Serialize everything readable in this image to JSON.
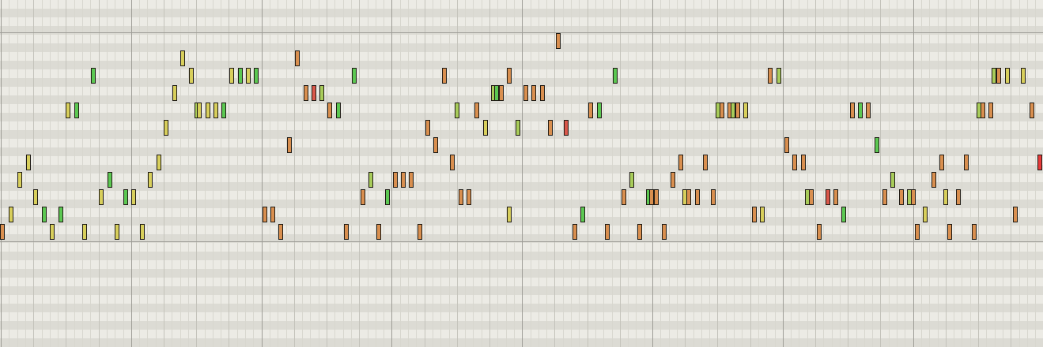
{
  "piano_roll": {
    "velocity_colors": {
      "green": "#5cc852",
      "lime": "#a8cc5a",
      "yellow": "#d8cf5c",
      "orange": "#d98f4f",
      "red": "#d9574a",
      "bright_red": "#e83a3a"
    },
    "notes": [
      {
        "time": 3,
        "pitch": 0,
        "color": "orange"
      },
      {
        "time": 14,
        "pitch": 1,
        "color": "yellow"
      },
      {
        "time": 25,
        "pitch": 3,
        "color": "yellow"
      },
      {
        "time": 36,
        "pitch": 4,
        "color": "yellow"
      },
      {
        "time": 45,
        "pitch": 2,
        "color": "yellow"
      },
      {
        "time": 56,
        "pitch": 1,
        "color": "green"
      },
      {
        "time": 66,
        "pitch": 0,
        "color": "yellow"
      },
      {
        "time": 77,
        "pitch": 1,
        "color": "green"
      },
      {
        "time": 86,
        "pitch": 7,
        "color": "yellow"
      },
      {
        "time": 97,
        "pitch": 7,
        "color": "green"
      },
      {
        "time": 107,
        "pitch": 0,
        "color": "yellow"
      },
      {
        "time": 118,
        "pitch": 9,
        "color": "green"
      },
      {
        "time": 128,
        "pitch": 2,
        "color": "yellow"
      },
      {
        "time": 139,
        "pitch": 3,
        "color": "green"
      },
      {
        "time": 148,
        "pitch": 0,
        "color": "yellow"
      },
      {
        "time": 159,
        "pitch": 2,
        "color": "green"
      },
      {
        "time": 169,
        "pitch": 2,
        "color": "yellow"
      },
      {
        "time": 180,
        "pitch": 0,
        "color": "yellow"
      },
      {
        "time": 190,
        "pitch": 3,
        "color": "yellow"
      },
      {
        "time": 201,
        "pitch": 4,
        "color": "yellow"
      },
      {
        "time": 210,
        "pitch": 6,
        "color": "yellow"
      },
      {
        "time": 221,
        "pitch": 8,
        "color": "yellow"
      },
      {
        "time": 231,
        "pitch": 10,
        "color": "yellow"
      },
      {
        "time": 242,
        "pitch": 9,
        "color": "yellow"
      },
      {
        "time": 249,
        "pitch": 7,
        "color": "lime"
      },
      {
        "time": 252,
        "pitch": 7,
        "color": "yellow"
      },
      {
        "time": 263,
        "pitch": 7,
        "color": "yellow"
      },
      {
        "time": 273,
        "pitch": 7,
        "color": "yellow"
      },
      {
        "time": 283,
        "pitch": 7,
        "color": "green"
      },
      {
        "time": 293,
        "pitch": 9,
        "color": "yellow"
      },
      {
        "time": 304,
        "pitch": 9,
        "color": "green"
      },
      {
        "time": 314,
        "pitch": 9,
        "color": "yellow"
      },
      {
        "time": 324,
        "pitch": 9,
        "color": "green"
      },
      {
        "time": 335,
        "pitch": 1,
        "color": "orange"
      },
      {
        "time": 345,
        "pitch": 1,
        "color": "orange"
      },
      {
        "time": 355,
        "pitch": 0,
        "color": "orange"
      },
      {
        "time": 366,
        "pitch": 5,
        "color": "orange"
      },
      {
        "time": 376,
        "pitch": 10,
        "color": "orange"
      },
      {
        "time": 387,
        "pitch": 8,
        "color": "orange"
      },
      {
        "time": 397,
        "pitch": 8,
        "color": "red"
      },
      {
        "time": 407,
        "pitch": 8,
        "color": "lime"
      },
      {
        "time": 417,
        "pitch": 7,
        "color": "orange"
      },
      {
        "time": 428,
        "pitch": 7,
        "color": "green"
      },
      {
        "time": 438,
        "pitch": 0,
        "color": "orange"
      },
      {
        "time": 448,
        "pitch": 9,
        "color": "green"
      },
      {
        "time": 459,
        "pitch": 2,
        "color": "orange"
      },
      {
        "time": 469,
        "pitch": 3,
        "color": "lime"
      },
      {
        "time": 479,
        "pitch": 0,
        "color": "orange"
      },
      {
        "time": 490,
        "pitch": 2,
        "color": "green"
      },
      {
        "time": 500,
        "pitch": 3,
        "color": "orange"
      },
      {
        "time": 510,
        "pitch": 3,
        "color": "orange"
      },
      {
        "time": 520,
        "pitch": 3,
        "color": "orange"
      },
      {
        "time": 531,
        "pitch": 0,
        "color": "orange"
      },
      {
        "time": 541,
        "pitch": 6,
        "color": "orange"
      },
      {
        "time": 551,
        "pitch": 5,
        "color": "orange"
      },
      {
        "time": 562,
        "pitch": 9,
        "color": "orange"
      },
      {
        "time": 572,
        "pitch": 4,
        "color": "orange"
      },
      {
        "time": 578,
        "pitch": 7,
        "color": "lime"
      },
      {
        "time": 583,
        "pitch": 2,
        "color": "orange"
      },
      {
        "time": 593,
        "pitch": 2,
        "color": "orange"
      },
      {
        "time": 603,
        "pitch": 7,
        "color": "orange"
      },
      {
        "time": 614,
        "pitch": 6,
        "color": "yellow"
      },
      {
        "time": 624,
        "pitch": 8,
        "color": "lime"
      },
      {
        "time": 628,
        "pitch": 8,
        "color": "green"
      },
      {
        "time": 634,
        "pitch": 8,
        "color": "orange"
      },
      {
        "time": 644,
        "pitch": 9,
        "color": "orange"
      },
      {
        "time": 644,
        "pitch": 1,
        "color": "yellow"
      },
      {
        "time": 655,
        "pitch": 6,
        "color": "lime"
      },
      {
        "time": 665,
        "pitch": 8,
        "color": "orange"
      },
      {
        "time": 675,
        "pitch": 8,
        "color": "orange"
      },
      {
        "time": 686,
        "pitch": 8,
        "color": "orange"
      },
      {
        "time": 696,
        "pitch": 6,
        "color": "orange"
      },
      {
        "time": 706,
        "pitch": 11,
        "color": "orange"
      },
      {
        "time": 716,
        "pitch": 6,
        "color": "red"
      },
      {
        "time": 727,
        "pitch": 0,
        "color": "orange"
      },
      {
        "time": 737,
        "pitch": 1,
        "color": "green"
      },
      {
        "time": 747,
        "pitch": 7,
        "color": "orange"
      },
      {
        "time": 758,
        "pitch": 7,
        "color": "green"
      },
      {
        "time": 768,
        "pitch": 0,
        "color": "orange"
      },
      {
        "time": 778,
        "pitch": 9,
        "color": "green"
      },
      {
        "time": 789,
        "pitch": 2,
        "color": "orange"
      },
      {
        "time": 799,
        "pitch": 3,
        "color": "lime"
      },
      {
        "time": 809,
        "pitch": 0,
        "color": "orange"
      },
      {
        "time": 820,
        "pitch": 2,
        "color": "green"
      },
      {
        "time": 824,
        "pitch": 2,
        "color": "orange"
      },
      {
        "time": 830,
        "pitch": 2,
        "color": "orange"
      },
      {
        "time": 840,
        "pitch": 0,
        "color": "orange"
      },
      {
        "time": 851,
        "pitch": 3,
        "color": "orange"
      },
      {
        "time": 861,
        "pitch": 4,
        "color": "orange"
      },
      {
        "time": 866,
        "pitch": 2,
        "color": "yellow"
      },
      {
        "time": 871,
        "pitch": 2,
        "color": "orange"
      },
      {
        "time": 882,
        "pitch": 2,
        "color": "orange"
      },
      {
        "time": 892,
        "pitch": 4,
        "color": "orange"
      },
      {
        "time": 902,
        "pitch": 2,
        "color": "orange"
      },
      {
        "time": 908,
        "pitch": 7,
        "color": "lime"
      },
      {
        "time": 913,
        "pitch": 7,
        "color": "orange"
      },
      {
        "time": 923,
        "pitch": 7,
        "color": "orange"
      },
      {
        "time": 927,
        "pitch": 7,
        "color": "lime"
      },
      {
        "time": 933,
        "pitch": 7,
        "color": "orange"
      },
      {
        "time": 943,
        "pitch": 7,
        "color": "yellow"
      },
      {
        "time": 954,
        "pitch": 1,
        "color": "orange"
      },
      {
        "time": 964,
        "pitch": 1,
        "color": "yellow"
      },
      {
        "time": 974,
        "pitch": 9,
        "color": "orange"
      },
      {
        "time": 985,
        "pitch": 9,
        "color": "lime"
      },
      {
        "time": 995,
        "pitch": 5,
        "color": "orange"
      },
      {
        "time": 1005,
        "pitch": 4,
        "color": "orange"
      },
      {
        "time": 1016,
        "pitch": 4,
        "color": "orange"
      },
      {
        "time": 1021,
        "pitch": 2,
        "color": "lime"
      },
      {
        "time": 1026,
        "pitch": 2,
        "color": "orange"
      },
      {
        "time": 1036,
        "pitch": 0,
        "color": "orange"
      },
      {
        "time": 1047,
        "pitch": 2,
        "color": "red"
      },
      {
        "time": 1057,
        "pitch": 2,
        "color": "orange"
      },
      {
        "time": 1067,
        "pitch": 1,
        "color": "green"
      },
      {
        "time": 1078,
        "pitch": 7,
        "color": "orange"
      },
      {
        "time": 1088,
        "pitch": 7,
        "color": "green"
      },
      {
        "time": 1098,
        "pitch": 7,
        "color": "orange"
      },
      {
        "time": 1109,
        "pitch": 5,
        "color": "green"
      },
      {
        "time": 1119,
        "pitch": 2,
        "color": "orange"
      },
      {
        "time": 1129,
        "pitch": 3,
        "color": "lime"
      },
      {
        "time": 1140,
        "pitch": 2,
        "color": "orange"
      },
      {
        "time": 1150,
        "pitch": 2,
        "color": "lime"
      },
      {
        "time": 1155,
        "pitch": 2,
        "color": "orange"
      },
      {
        "time": 1160,
        "pitch": 0,
        "color": "orange"
      },
      {
        "time": 1170,
        "pitch": 1,
        "color": "yellow"
      },
      {
        "time": 1181,
        "pitch": 3,
        "color": "orange"
      },
      {
        "time": 1191,
        "pitch": 4,
        "color": "orange"
      },
      {
        "time": 1196,
        "pitch": 2,
        "color": "yellow"
      },
      {
        "time": 1201,
        "pitch": 0,
        "color": "orange"
      },
      {
        "time": 1212,
        "pitch": 2,
        "color": "orange"
      },
      {
        "time": 1222,
        "pitch": 4,
        "color": "orange"
      },
      {
        "time": 1232,
        "pitch": 0,
        "color": "orange"
      },
      {
        "time": 1238,
        "pitch": 7,
        "color": "lime"
      },
      {
        "time": 1243,
        "pitch": 7,
        "color": "orange"
      },
      {
        "time": 1253,
        "pitch": 7,
        "color": "orange"
      },
      {
        "time": 1257,
        "pitch": 9,
        "color": "lime"
      },
      {
        "time": 1263,
        "pitch": 9,
        "color": "orange"
      },
      {
        "time": 1274,
        "pitch": 9,
        "color": "yellow"
      },
      {
        "time": 1284,
        "pitch": 1,
        "color": "orange"
      },
      {
        "time": 1294,
        "pitch": 9,
        "color": "yellow"
      },
      {
        "time": 1305,
        "pitch": 7,
        "color": "orange"
      },
      {
        "time": 1315,
        "pitch": 4,
        "color": "bright_red"
      }
    ]
  }
}
